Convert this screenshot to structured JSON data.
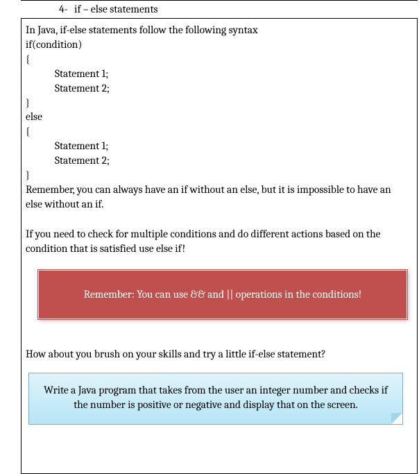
{
  "heading": {
    "number": "4-",
    "text": "if – else statements"
  },
  "body": {
    "intro": "In Java, if-else statements follow the following syntax",
    "code": {
      "l1": "if(condition)",
      "l2": "{",
      "l3": "Statement 1;",
      "l4": "Statement 2;",
      "l5": "}",
      "l6": "else",
      "l7": "{",
      "l8": "Statement 1;",
      "l9": "Statement 2;",
      "l10": "}"
    },
    "remember": "Remember, you can always have an if without an else, but it is impossible to have an else without an if.",
    "elseif": "If you need to check for multiple conditions and do different actions based on the condition that is satisfied use else if!",
    "red_callout": "Remember: You can use && and || operations in the conditions!",
    "prompt": "How about you brush on your skills and try a little if-else statement?",
    "blue_callout": "Write a Java program that takes from the user an integer number and checks if the number is positive or negative and display that on the screen."
  }
}
